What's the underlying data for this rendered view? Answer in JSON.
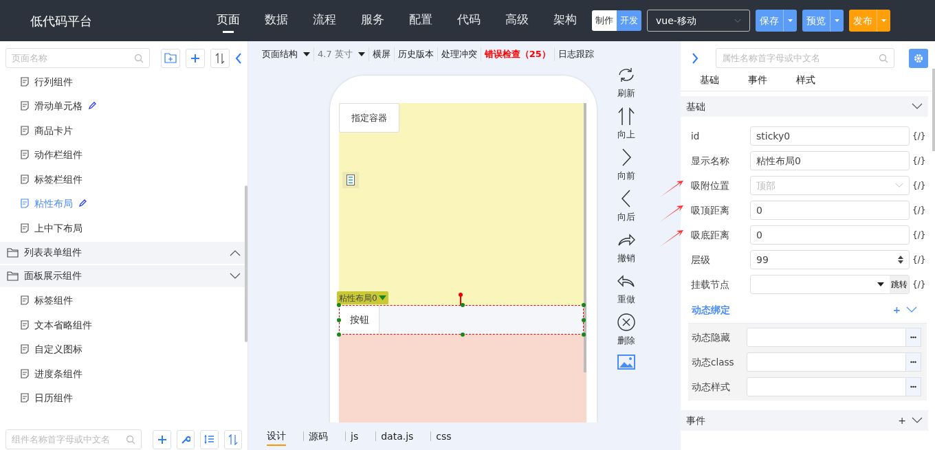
{
  "app_title": "低代码平台",
  "nav": [
    {
      "label": "页面",
      "selected": true
    },
    {
      "label": "数据",
      "selected": false
    },
    {
      "label": "流程",
      "selected": false
    },
    {
      "label": "服务",
      "selected": false
    },
    {
      "label": "配置",
      "selected": false
    },
    {
      "label": "代码",
      "selected": false
    },
    {
      "label": "高级",
      "selected": false
    },
    {
      "label": "架构",
      "selected": false
    }
  ],
  "mode_toggle": [
    {
      "label": "制作",
      "selected": false
    },
    {
      "label": "开发",
      "selected": true
    }
  ],
  "framework_select": {
    "value": "vue-移动"
  },
  "actions": [
    {
      "label": "保存",
      "kind": "primary"
    },
    {
      "label": "预览",
      "kind": "primary"
    },
    {
      "label": "发布",
      "kind": "warning"
    }
  ],
  "page_tree": {
    "search_placeholder": "页面名称",
    "items": [
      {
        "kind": "page",
        "label": "行列组件",
        "selected": false,
        "editable": false
      },
      {
        "kind": "page",
        "label": "滑动单元格",
        "selected": false,
        "editable": true
      },
      {
        "kind": "page",
        "label": "商品卡片",
        "selected": false,
        "editable": false
      },
      {
        "kind": "page",
        "label": "动作栏组件",
        "selected": false,
        "editable": false
      },
      {
        "kind": "page",
        "label": "标签栏组件",
        "selected": false,
        "editable": false
      },
      {
        "kind": "page",
        "label": "粘性布局",
        "selected": true,
        "editable": true
      },
      {
        "kind": "page",
        "label": "上中下布局",
        "selected": false,
        "editable": false
      },
      {
        "kind": "group",
        "label": "列表表单组件",
        "expanded": false
      },
      {
        "kind": "group",
        "label": "面板展示组件",
        "expanded": true,
        "children": [
          {
            "kind": "page",
            "label": "标签组件",
            "selected": false,
            "editable": false
          },
          {
            "kind": "page",
            "label": "文本省略组件",
            "selected": false,
            "editable": false
          },
          {
            "kind": "page",
            "label": "自定义图标",
            "selected": false,
            "editable": false
          },
          {
            "kind": "page",
            "label": "进度条组件",
            "selected": false,
            "editable": false
          },
          {
            "kind": "page",
            "label": "日历组件",
            "selected": false,
            "editable": false
          }
        ]
      }
    ]
  },
  "component_search": {
    "placeholder": "组件名称首字母或中文名"
  },
  "toolbar": [
    {
      "label": "页面结构",
      "kind": "dropdown"
    },
    {
      "label": "4.7 英寸",
      "kind": "dropdown-muted"
    },
    {
      "label": "横屏",
      "kind": "link"
    },
    {
      "label": "历史版本",
      "kind": "link"
    },
    {
      "label": "处理冲突",
      "kind": "link"
    },
    {
      "label": "错误检查（25）",
      "kind": "error"
    },
    {
      "label": "日志跟踪",
      "kind": "link"
    }
  ],
  "canvas": {
    "container_label": "指定容器",
    "sticky_tag": "粘性布局0",
    "button_label": "按钮"
  },
  "side_tools": [
    {
      "kind": "refresh",
      "label": "刷新"
    },
    {
      "kind": "up",
      "label": "向上"
    },
    {
      "kind": "forward",
      "label": "向前"
    },
    {
      "kind": "back",
      "label": "向后"
    },
    {
      "kind": "undo",
      "label": "撤销"
    },
    {
      "kind": "redo",
      "label": "重做"
    },
    {
      "kind": "delete",
      "label": "删除"
    },
    {
      "kind": "image"
    }
  ],
  "bottom_tabs": [
    {
      "label": "设计",
      "selected": true
    },
    {
      "label": "源码",
      "selected": false
    },
    {
      "label": "js",
      "selected": false
    },
    {
      "label": "data.js",
      "selected": false
    },
    {
      "label": "css",
      "selected": false
    }
  ],
  "properties": {
    "search_placeholder": "属性名称首字母或中文名",
    "tabs": [
      {
        "label": "基础"
      },
      {
        "label": "事件"
      },
      {
        "label": "样式"
      }
    ],
    "basic_header": "基础",
    "fields": [
      {
        "kind": "text",
        "label": "id",
        "value": "sticky0",
        "bind": "{/}",
        "marked": false
      },
      {
        "kind": "text",
        "label": "显示名称",
        "value": "粘性布局0",
        "bind": "{/}",
        "marked": false
      },
      {
        "kind": "select",
        "label": "吸附位置",
        "placeholder": "顶部",
        "bind": "{/}",
        "marked": true
      },
      {
        "kind": "text",
        "label": "吸顶距离",
        "value": "0",
        "bind": "{/}",
        "marked": true
      },
      {
        "kind": "text",
        "label": "吸底距离",
        "value": "0",
        "bind": "{/}",
        "marked": true
      },
      {
        "kind": "number",
        "label": "层级",
        "value": "99",
        "bind": "{/}",
        "marked": false
      },
      {
        "kind": "mount",
        "label": "挂载节点",
        "button": "跳转",
        "bind": "{/}",
        "marked": false
      }
    ],
    "binding_header": {
      "label": "动态绑定",
      "add": "+"
    },
    "binding_fields": [
      {
        "label": "动态隐藏"
      },
      {
        "label": "动态class"
      },
      {
        "label": "动态样式"
      }
    ],
    "events_header": {
      "label": "事件",
      "add": "+"
    }
  }
}
